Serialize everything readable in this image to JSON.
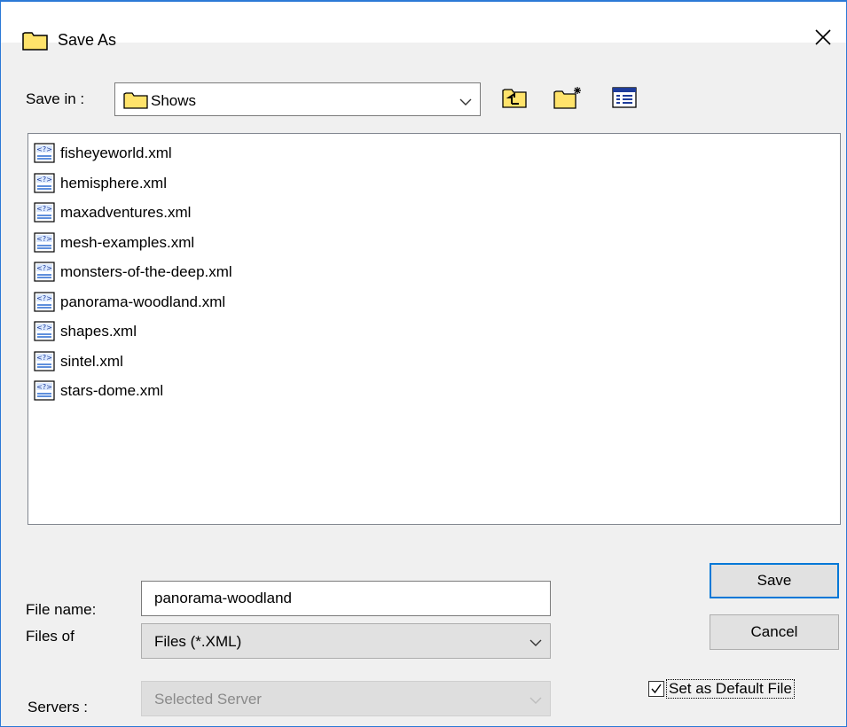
{
  "dialog": {
    "title": "Save As",
    "title_icon": "folder-icon",
    "close_icon": "close-icon"
  },
  "save_in": {
    "label": "Save in :",
    "value": "Shows",
    "icon": "folder-icon",
    "toolbar": {
      "up_icon": "up-one-level-icon",
      "new_folder_icon": "new-folder-icon",
      "details_icon": "details-view-icon"
    }
  },
  "files": [
    {
      "name": "fisheyeworld.xml",
      "icon": "xml-file-icon"
    },
    {
      "name": "hemisphere.xml",
      "icon": "xml-file-icon"
    },
    {
      "name": "maxadventures.xml",
      "icon": "xml-file-icon"
    },
    {
      "name": "mesh-examples.xml",
      "icon": "xml-file-icon"
    },
    {
      "name": "monsters-of-the-deep.xml",
      "icon": "xml-file-icon"
    },
    {
      "name": "panorama-woodland.xml",
      "icon": "xml-file-icon"
    },
    {
      "name": "shapes.xml",
      "icon": "xml-file-icon"
    },
    {
      "name": "sintel.xml",
      "icon": "xml-file-icon"
    },
    {
      "name": "stars-dome.xml",
      "icon": "xml-file-icon"
    }
  ],
  "file_name": {
    "label": "File name:",
    "value": "panorama-woodland"
  },
  "files_of": {
    "label": "Files of",
    "value": "Files (*.XML)"
  },
  "servers": {
    "label": "Servers :",
    "value": "Selected Server",
    "disabled": true
  },
  "buttons": {
    "save": "Save",
    "cancel": "Cancel"
  },
  "default_file": {
    "label": "Set as Default File",
    "checked": true
  },
  "colors": {
    "accent": "#0078d7",
    "window_border": "#2b79d6",
    "folder_yellow": "#ffe36b"
  }
}
